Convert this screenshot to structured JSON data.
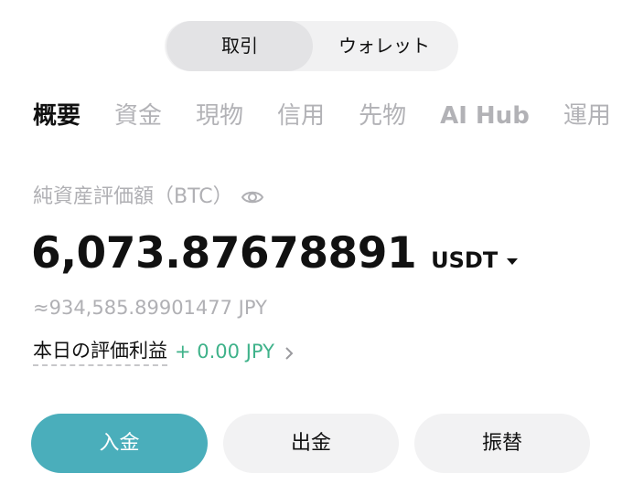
{
  "segment": {
    "active_label": "取引",
    "inactive_label": "ウォレット"
  },
  "tabs": [
    {
      "label": "概要",
      "active": true
    },
    {
      "label": "資金",
      "active": false
    },
    {
      "label": "現物",
      "active": false
    },
    {
      "label": "信用",
      "active": false
    },
    {
      "label": "先物",
      "active": false
    },
    {
      "label": "AI Hub",
      "active": false
    },
    {
      "label": "運用",
      "active": false
    }
  ],
  "balance": {
    "label": "純資産評価額（BTC）",
    "visibility_icon": "eye-icon",
    "value": "6,073.87678891",
    "unit": "USDT",
    "jpy_equivalent": "≈934,585.89901477 JPY"
  },
  "pnl": {
    "label": "本日の評価利益",
    "value": "+ 0.00 JPY"
  },
  "actions": {
    "deposit": "入金",
    "withdraw": "出金",
    "transfer": "振替"
  },
  "colors": {
    "accent": "#4aaebb",
    "positive": "#3fb28a",
    "muted": "#b0b0b4"
  }
}
